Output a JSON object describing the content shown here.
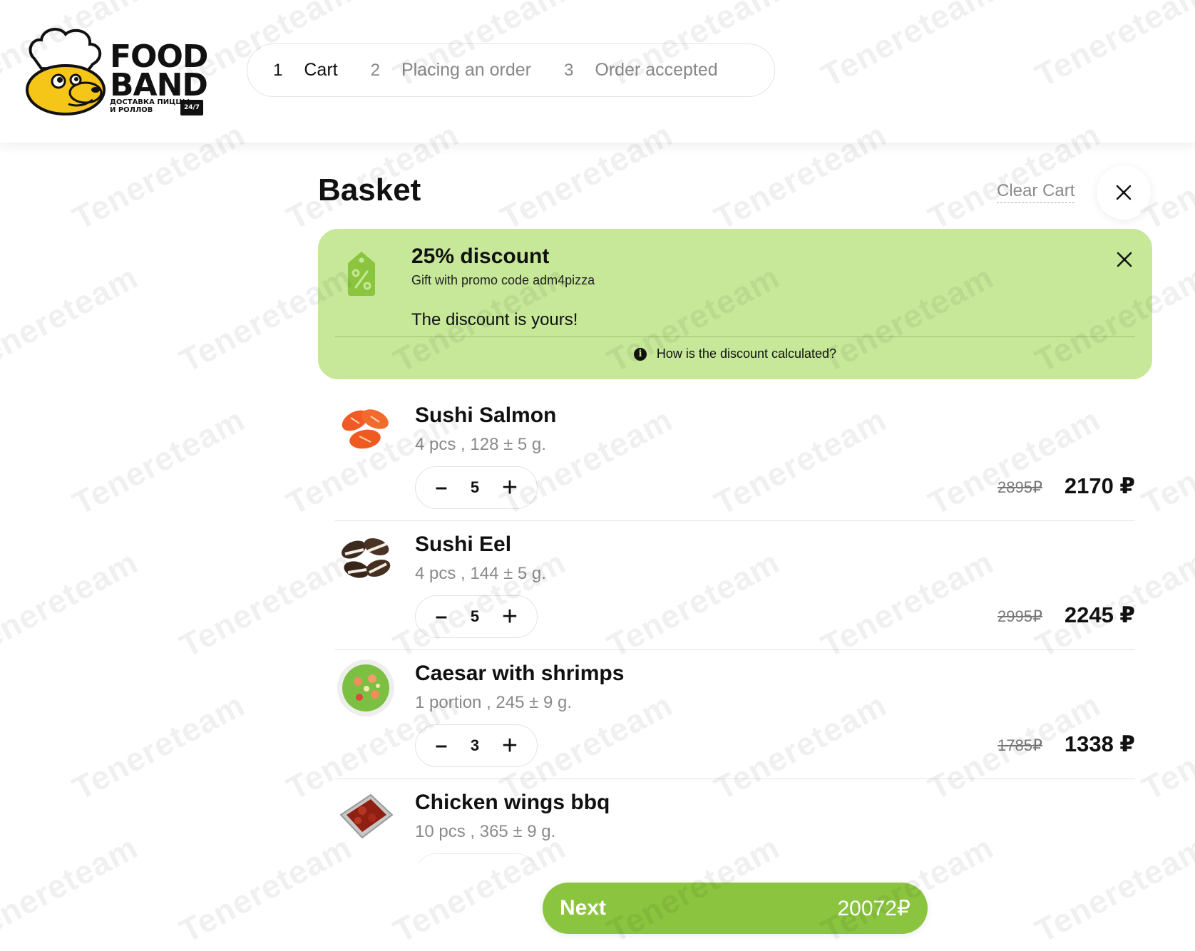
{
  "brand": {
    "line1": "FOOD",
    "line2": "BAND",
    "subtitle_1": "ДОСТАВКА ПИЦЦЫ",
    "subtitle_2": "И РОЛЛОВ",
    "badge": "24/7"
  },
  "steps": [
    {
      "num": "1",
      "label": "Cart",
      "active": true
    },
    {
      "num": "2",
      "label": "Placing an order",
      "active": false
    },
    {
      "num": "3",
      "label": "Order accepted",
      "active": false
    }
  ],
  "basket": {
    "title": "Basket",
    "clear_label": "Clear Cart"
  },
  "promo": {
    "title": "25% discount",
    "subtitle": "Gift with promo code adm4pizza",
    "status": "The discount is yours!",
    "info_link": "How is the discount calculated?",
    "info_icon": "i",
    "bg_color": "#c6e898",
    "tag_color": "#8bc53f"
  },
  "items": [
    {
      "name": "Sushi Salmon",
      "meta": "4 pcs ,  128 ± 5  g.",
      "qty": "5",
      "old_price": "2895₽",
      "price": "2170  ₽",
      "image": "sushi-salmon-image"
    },
    {
      "name": "Sushi Eel",
      "meta": "4 pcs ,  144 ± 5  g.",
      "qty": "5",
      "old_price": "2995₽",
      "price": "2245  ₽",
      "image": "sushi-eel-image"
    },
    {
      "name": "Caesar with shrimps",
      "meta": "1 portion ,  245 ± 9  g.",
      "qty": "3",
      "old_price": "1785₽",
      "price": "1338  ₽",
      "image": "caesar-salad-image"
    },
    {
      "name": "Chicken wings bbq",
      "meta": "10 pcs ,  365 ± 9  g.",
      "qty": "",
      "old_price": "",
      "price": "",
      "image": "chicken-wings-image"
    }
  ],
  "stepper": {
    "minus": "–",
    "plus": "+"
  },
  "next": {
    "label": "Next",
    "total": "20072₽",
    "color": "#8bc53f"
  },
  "watermark": "Tenereteam"
}
